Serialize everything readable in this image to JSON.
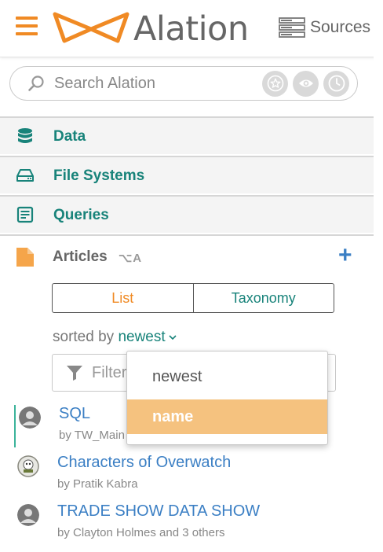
{
  "header": {
    "logo_text": "Alation",
    "sources_label": "Sources",
    "brand_color": "#f08a24"
  },
  "search": {
    "placeholder": "Search Alation"
  },
  "nav": {
    "items": [
      {
        "label": "Data",
        "icon": "database-icon"
      },
      {
        "label": "File Systems",
        "icon": "hard-drive-icon"
      },
      {
        "label": "Queries",
        "icon": "query-icon"
      }
    ],
    "accent_color": "#18837a"
  },
  "articles": {
    "title": "Articles",
    "shortcut": "⌥A",
    "add_label": "+",
    "tabs": {
      "list": "List",
      "taxonomy": "Taxonomy"
    },
    "sorted_by_prefix": "sorted by",
    "sorted_by_value": "newest",
    "filter_placeholder": "Filter",
    "items": [
      {
        "title": "SQL",
        "author": "by TW_Main"
      },
      {
        "title": "Characters of Overwatch",
        "author": "by Pratik Kabra"
      },
      {
        "title": "TRADE SHOW DATA SHOW",
        "author": "by Clayton Holmes and 3 others"
      }
    ]
  },
  "sort_dropdown": {
    "options": [
      "newest",
      "name"
    ],
    "highlighted": "name",
    "highlight_color": "#f5c27f"
  }
}
